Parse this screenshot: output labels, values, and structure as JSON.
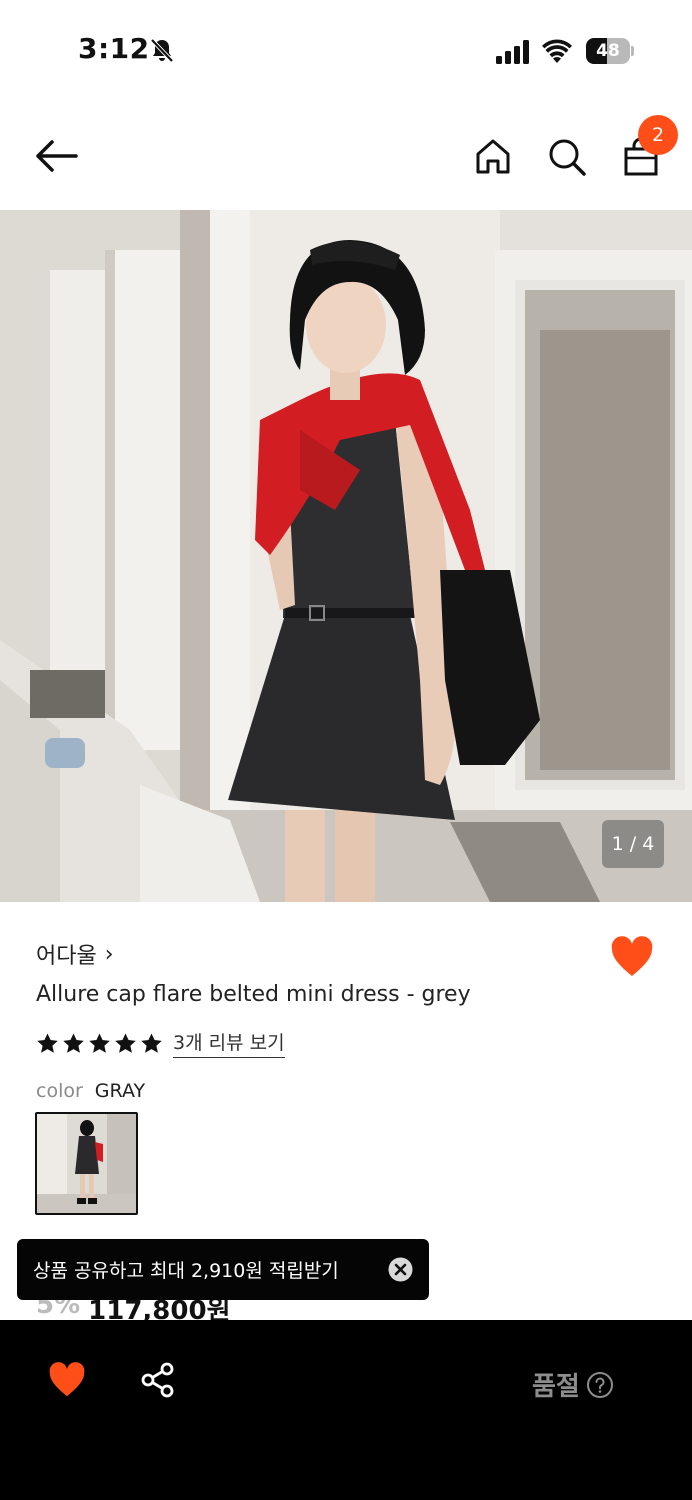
{
  "status_bar": {
    "time": "3:12",
    "battery": "48",
    "battery_level_percent": 48
  },
  "header": {
    "cart_count": "2"
  },
  "gallery": {
    "indicator": "1 / 4"
  },
  "product": {
    "brand": "어다울",
    "brand_chevron": "›",
    "name": "Allure cap flare belted mini dress - grey",
    "rating_stars": 5,
    "review_link": "3개 리뷰 보기",
    "option_label": "color",
    "option_value": "GRAY",
    "discount": "5%",
    "price": "117,800원"
  },
  "toast": {
    "message": "상품 공유하고 최대 2,910원 적립받기"
  },
  "bottom_bar": {
    "status": "품절"
  },
  "colors": {
    "accent": "#ff4e17",
    "toast_bg": "#050505",
    "bottom_bar_bg": "#000000"
  },
  "icons": [
    "bell-slash-icon",
    "signal-icon",
    "wifi-icon",
    "back-arrow-icon",
    "home-icon",
    "search-icon",
    "cart-icon",
    "heart-icon",
    "star-icon",
    "close-icon",
    "share-icon",
    "help-icon"
  ]
}
